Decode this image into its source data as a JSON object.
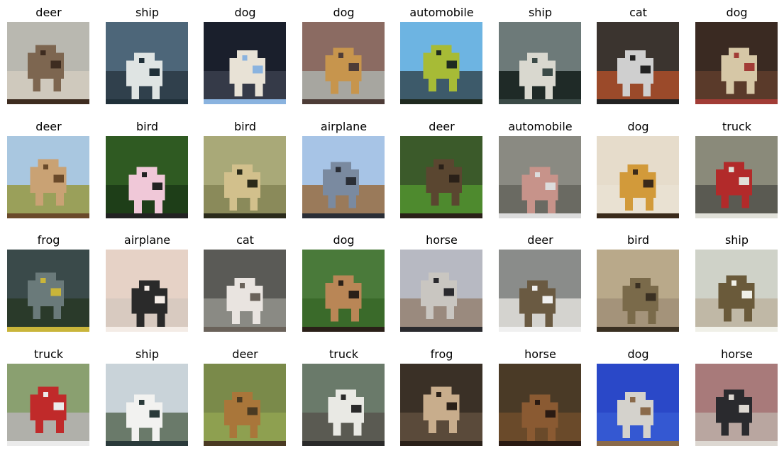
{
  "grid": {
    "rows": 4,
    "columns": 8,
    "items": [
      {
        "label": "deer",
        "colors": {
          "sky": "#b9b8b0",
          "ground": "#cfc9bd",
          "subject": "#7d6650",
          "accent": "#3e2c20"
        }
      },
      {
        "label": "ship",
        "colors": {
          "sky": "#4d6679",
          "ground": "#30404c",
          "subject": "#dfe4e3",
          "accent": "#203039"
        }
      },
      {
        "label": "dog",
        "colors": {
          "sky": "#1a1f2c",
          "ground": "#353a48",
          "subject": "#e8e2d6",
          "accent": "#8ab3df"
        }
      },
      {
        "label": "dog",
        "colors": {
          "sky": "#8b6b62",
          "ground": "#a7a6a0",
          "subject": "#c7954d",
          "accent": "#4d3c37"
        }
      },
      {
        "label": "automobile",
        "colors": {
          "sky": "#6db4e2",
          "ground": "#3d5a6a",
          "subject": "#a7bb36",
          "accent": "#1f2a20"
        }
      },
      {
        "label": "ship",
        "colors": {
          "sky": "#6d7a79",
          "ground": "#1f2a27",
          "subject": "#d9d8cf",
          "accent": "#3b4a47"
        }
      },
      {
        "label": "cat",
        "colors": {
          "sky": "#3b342f",
          "ground": "#9b4a2a",
          "subject": "#cfcfcf",
          "accent": "#222222"
        }
      },
      {
        "label": "dog",
        "colors": {
          "sky": "#3a2a22",
          "ground": "#5a3a2a",
          "subject": "#d6c7a6",
          "accent": "#a23c36"
        }
      },
      {
        "label": "deer",
        "colors": {
          "sky": "#a9c7e0",
          "ground": "#9aa05a",
          "subject": "#c9a274",
          "accent": "#6a4a2a"
        }
      },
      {
        "label": "bird",
        "colors": {
          "sky": "#2f5a22",
          "ground": "#1e3e18",
          "subject": "#f0c8d8",
          "accent": "#222222"
        }
      },
      {
        "label": "bird",
        "colors": {
          "sky": "#a9a978",
          "ground": "#8a8a5a",
          "subject": "#d2c08c",
          "accent": "#2a2a1a"
        }
      },
      {
        "label": "airplane",
        "colors": {
          "sky": "#a7c4e6",
          "ground": "#9a7a5a",
          "subject": "#7a8aa0",
          "accent": "#2a2e36"
        }
      },
      {
        "label": "deer",
        "colors": {
          "sky": "#3b5a2a",
          "ground": "#4e8a2e",
          "subject": "#5a4630",
          "accent": "#2a2018"
        }
      },
      {
        "label": "automobile",
        "colors": {
          "sky": "#8a8a82",
          "ground": "#6a6a62",
          "subject": "#c7938a",
          "accent": "#dcdcdc"
        }
      },
      {
        "label": "dog",
        "colors": {
          "sky": "#e6dccb",
          "ground": "#e9e1d2",
          "subject": "#d29a3a",
          "accent": "#3a2a1a"
        }
      },
      {
        "label": "truck",
        "colors": {
          "sky": "#8a8a7a",
          "ground": "#5a5a52",
          "subject": "#b22a2a",
          "accent": "#e0e0d8"
        }
      },
      {
        "label": "frog",
        "colors": {
          "sky": "#3a4a4a",
          "ground": "#2a3a2a",
          "subject": "#6a7a7a",
          "accent": "#c9b53a"
        }
      },
      {
        "label": "airplane",
        "colors": {
          "sky": "#e6d2c6",
          "ground": "#d8cac0",
          "subject": "#2a2a2a",
          "accent": "#f4ece6"
        }
      },
      {
        "label": "cat",
        "colors": {
          "sky": "#5a5a56",
          "ground": "#8a8a84",
          "subject": "#e9e4e0",
          "accent": "#6a625a"
        }
      },
      {
        "label": "dog",
        "colors": {
          "sky": "#4a7a3a",
          "ground": "#3a6a2a",
          "subject": "#b98656",
          "accent": "#2a2018"
        }
      },
      {
        "label": "horse",
        "colors": {
          "sky": "#b7b9c2",
          "ground": "#9a8a7e",
          "subject": "#c9c6c1",
          "accent": "#2a2a2e"
        }
      },
      {
        "label": "deer",
        "colors": {
          "sky": "#8a8c8a",
          "ground": "#d4d3cf",
          "subject": "#6a5a42",
          "accent": "#f0f0f0"
        }
      },
      {
        "label": "bird",
        "colors": {
          "sky": "#b9a98a",
          "ground": "#a4937a",
          "subject": "#7a6a4a",
          "accent": "#3a3022"
        }
      },
      {
        "label": "ship",
        "colors": {
          "sky": "#cfd2c8",
          "ground": "#c0b8a6",
          "subject": "#6a5a3a",
          "accent": "#f0f0e8"
        }
      },
      {
        "label": "truck",
        "colors": {
          "sky": "#8aa070",
          "ground": "#b0b0aa",
          "subject": "#c02a2a",
          "accent": "#ebebeb"
        }
      },
      {
        "label": "ship",
        "colors": {
          "sky": "#c9d3d9",
          "ground": "#6a7a6a",
          "subject": "#f2f2f0",
          "accent": "#2a3a3a"
        }
      },
      {
        "label": "deer",
        "colors": {
          "sky": "#7a8a4a",
          "ground": "#8ea050",
          "subject": "#a9763a",
          "accent": "#4a3a22"
        }
      },
      {
        "label": "truck",
        "colors": {
          "sky": "#6a7a6a",
          "ground": "#5a5a52",
          "subject": "#e9e9e4",
          "accent": "#2a2a2a"
        }
      },
      {
        "label": "frog",
        "colors": {
          "sky": "#3a3026",
          "ground": "#5a4a3a",
          "subject": "#c8ad8c",
          "accent": "#2a2018"
        }
      },
      {
        "label": "horse",
        "colors": {
          "sky": "#4a3a26",
          "ground": "#6a4a2a",
          "subject": "#8a5a32",
          "accent": "#2a1a12"
        }
      },
      {
        "label": "dog",
        "colors": {
          "sky": "#2a48c8",
          "ground": "#3458d2",
          "subject": "#d4d2cc",
          "accent": "#8a6a4a"
        }
      },
      {
        "label": "horse",
        "colors": {
          "sky": "#a87a7a",
          "ground": "#b9a6a0",
          "subject": "#2a2a2e",
          "accent": "#ddd8d2"
        }
      }
    ]
  }
}
